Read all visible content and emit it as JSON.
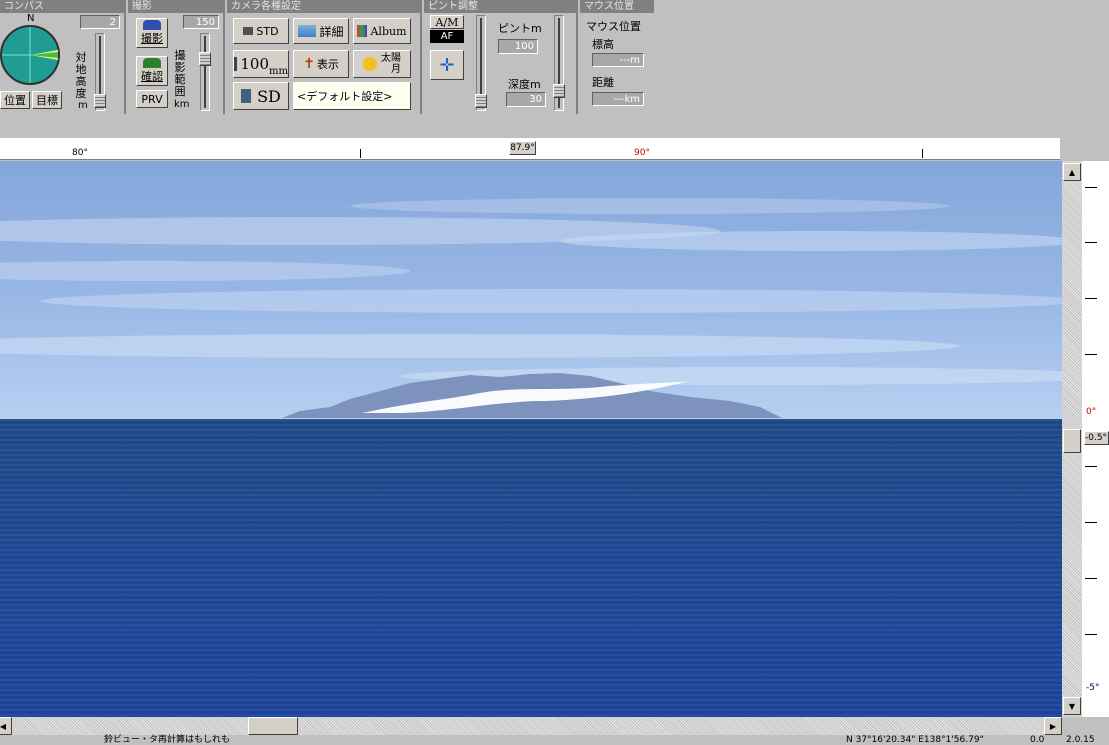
{
  "compass": {
    "header": "コンパス",
    "north": "N",
    "height_value": "2",
    "height_label": "対地高度",
    "height_unit": "m",
    "position_button": "位置",
    "target_button": "目標"
  },
  "shoot": {
    "header": "撮影",
    "shoot_button": "撮影",
    "confirm_button": "確認",
    "prv_button": "PRV",
    "range_value": "150",
    "range_label": "撮影範囲",
    "range_unit": "km"
  },
  "camera": {
    "header": "カメラ各種設定",
    "std_button": "STD",
    "detail_button": "詳細",
    "album_button": "Album",
    "lens_value": "100",
    "lens_unit": "mm",
    "display_button": "表示",
    "sun_moon_top": "太陽",
    "sun_moon_bottom": "月",
    "sd_button": "SD",
    "default_settings_button": "<デフォルト設定>"
  },
  "focus": {
    "header": "ピント調整",
    "am_button": "A/M",
    "af_label": "AF",
    "focus_label": "ピントm",
    "focus_value": "100",
    "depth_label": "深度m",
    "depth_value": "30"
  },
  "mouse": {
    "header": "マウス位置",
    "elevation_label": "標高",
    "elevation_value": "---m",
    "distance_label": "距離",
    "distance_value": "---km"
  },
  "ruler": {
    "left_label": "80°",
    "center_label": "87.9°",
    "right_label": "90°"
  },
  "vscale": {
    "top_label": "0°",
    "current_label": "-0.5°",
    "bottom_label": "-5°"
  },
  "status": {
    "message": "鈴ビュー・タ再計算はもしれも",
    "coords": "N 37°16'20.34\" E138°1'56.79\"",
    "scale": "0.0",
    "extra": "2.0.15"
  },
  "colors": {
    "sky_top": "#84a6da",
    "sea": "#204c98",
    "panel": "#c0c0c0"
  }
}
